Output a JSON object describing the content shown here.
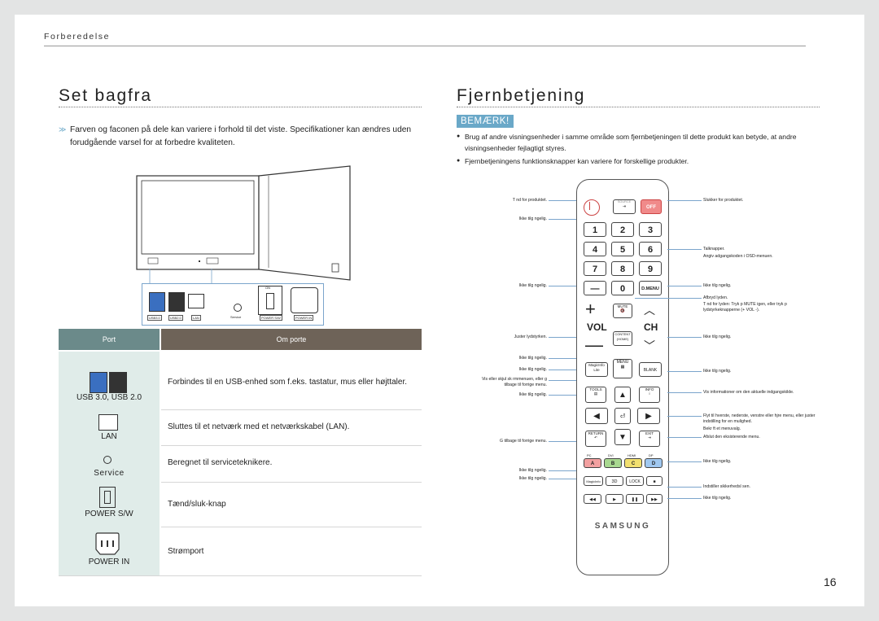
{
  "chapter": "Forberedelse",
  "page_number": "16",
  "left": {
    "title": "Set bagfra",
    "note": "Farven og faconen på dele kan variere i forhold til det viste. Specifikationer kan ændres uden forudgående varsel for at forbedre kvaliteten.",
    "back_labels": {
      "usb1": "USB3.0",
      "usb2": "USB2.0",
      "lan": "LAN",
      "service": "Service",
      "power_sw": "POWER S/W",
      "power_in": "POWER IN",
      "on": "ON"
    },
    "table": {
      "col_port": "Port",
      "col_about": "Om porte",
      "rows": [
        {
          "port": "USB 3.0, USB 2.0",
          "desc": "Forbindes til en USB-enhed som f.eks. tastatur, mus eller højttaler.",
          "icon": "usb-ports-icon"
        },
        {
          "port": "LAN",
          "desc": "Sluttes til et netværk med et netværkskabel (LAN).",
          "icon": "lan-port-icon"
        },
        {
          "port": "Service",
          "desc": "Beregnet til serviceteknikere.",
          "icon": "service-port-icon"
        },
        {
          "port": "POWER S/W",
          "desc": "Tænd/sluk-knap",
          "icon": "power-switch-icon"
        },
        {
          "port": "POWER IN",
          "desc": "Strømport",
          "icon": "power-in-icon"
        }
      ]
    }
  },
  "right": {
    "title": "Fjernbetjening",
    "badge": "BEMÆRK!",
    "bullets": [
      "Brug af andre visningsenheder i samme område som fjernbetjeningen til dette produkt kan betyde, at andre visningsenheder fejlagtigt styres.",
      "Fjernbetjeningens funktionsknapper kan variere for forskellige produkter."
    ],
    "remote": {
      "source": "SOURCE",
      "off": "OFF",
      "digits": [
        "1",
        "2",
        "3",
        "4",
        "5",
        "6",
        "7",
        "8",
        "9",
        "0"
      ],
      "dmenu": "D.MENU",
      "mute": "MUTE",
      "vol": "VOL",
      "ch": "CH",
      "content": "CONTENT",
      "home": "(HOME)",
      "magicinfo": "MagicInfo",
      "lite": "Lite",
      "menu": "MENU",
      "blank": "BLANK",
      "tools": "TOOLS",
      "info": "INFO",
      "return": "RETURN",
      "exit": "EXIT",
      "pc": "PC",
      "dvi": "DVI",
      "hdmi": "HDMI",
      "dp": "DP",
      "a": "A",
      "b": "B",
      "c": "C",
      "d": "D",
      "magicinfo2": "MagicInfo",
      "three_d": "3D",
      "lock": "LOCK",
      "brand": "SAMSUNG"
    },
    "callouts_left": [
      "T nd for produktet.",
      "Ikke tilg ngelig.",
      "Ikke tilg ngelig.",
      "Juster lydstyrken.",
      "Ikke tilg ngelig.",
      "Ikke tilg ngelig.",
      "Vis eller skjul sk rmmenuen, eller g tilbage til forrige menu.",
      "Ikke tilg ngelig.",
      "G tilbage til forrige menu.",
      "Ikke tilg ngelig.",
      "Ikke tilg ngelig."
    ],
    "callouts_right": [
      "Slukker for produktet.",
      "Talknapper.",
      "Angiv adgangskoden i OSD-menuen.",
      "Ikke tilg ngelig.",
      "Afbryd lyden.",
      "T nd for lyden: Tryk p MUTE igen, eller tryk p lydstyrkeknapperne (+ VOL -).",
      "Ikke tilg ngelig.",
      "Ikke tilg ngelig.",
      "Vis informationer om den aktuelle indgangskilde.",
      "Flyt til hverste, nederste, venstre eller hjre menu, eller juster indstilling for en mulighed.",
      "Bekr ft et menuvalg.",
      "Afslut den eksisterende menu.",
      "Ikke tilg ngelig.",
      "Indstiller sikkerhedsl sen.",
      "Ikke tilg ngelig."
    ]
  },
  "colors": {
    "accent_blue": "#6aa8c8",
    "table_head_port": "#6b8a8a",
    "table_head_about": "#6e6358",
    "table_port_cell": "#e0ece9",
    "callout_blue": "#7ba5cc",
    "btn_red": "#f08a8a",
    "btn_a": "#f2a0a0",
    "btn_b": "#a8d890",
    "btn_c": "#f2e070",
    "btn_d": "#a0c8f0"
  }
}
